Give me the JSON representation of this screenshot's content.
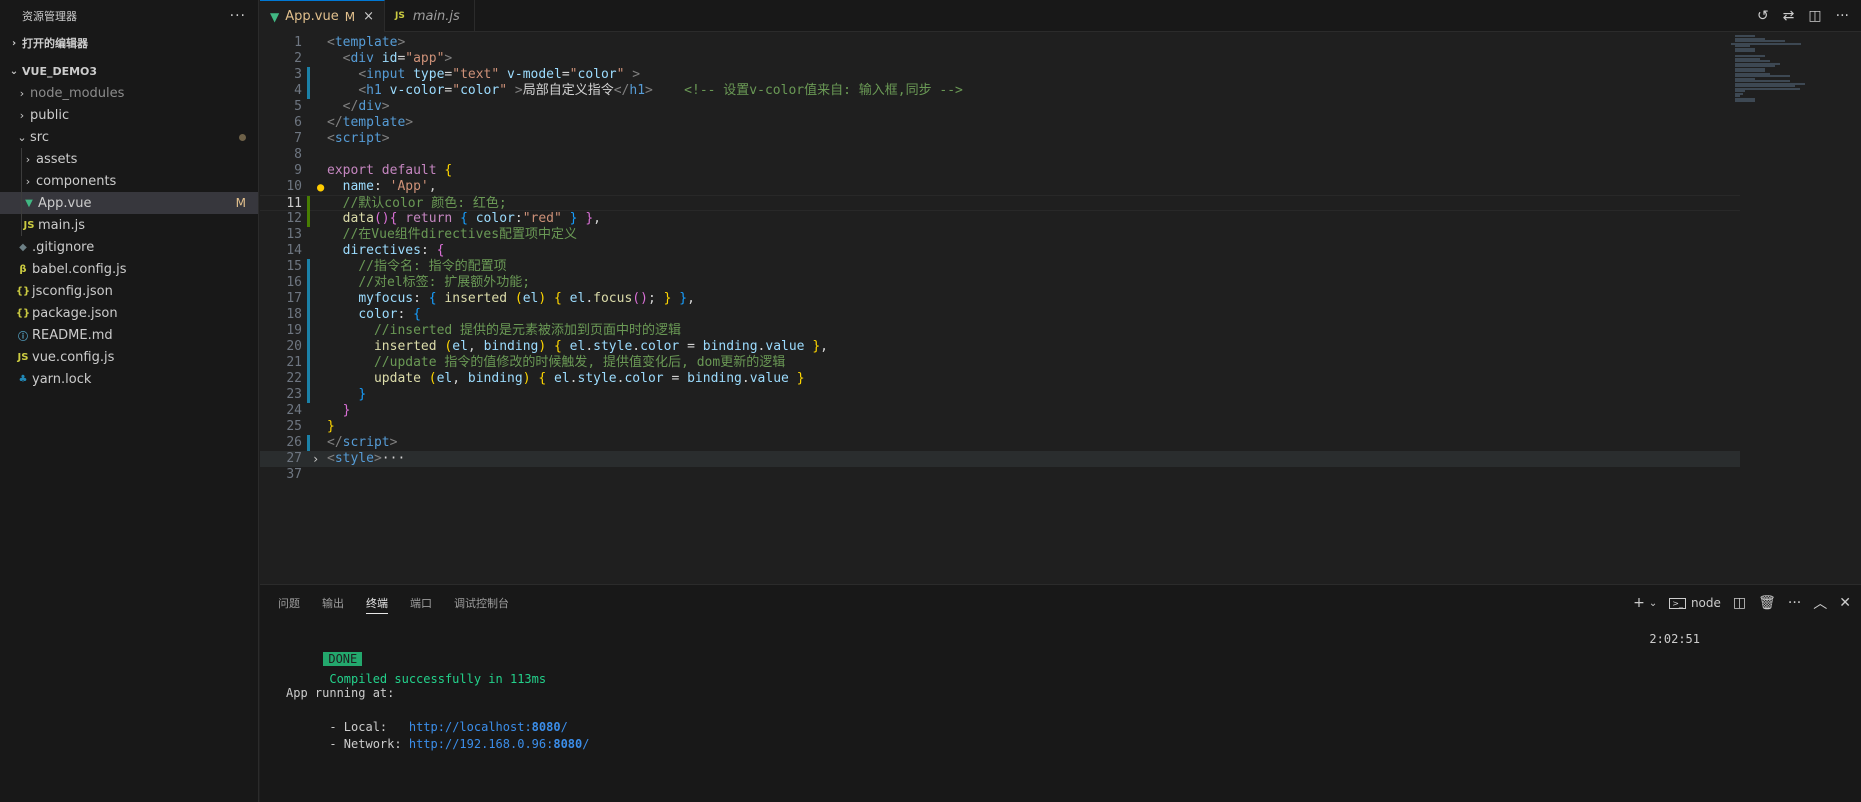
{
  "sidebar": {
    "title": "资源管理器",
    "more": "···",
    "open_editors": "打开的编辑器",
    "project": "VUE_DEMO3",
    "items": [
      {
        "label": "node_modules",
        "kind": "folder",
        "chevron": "›",
        "icon": "",
        "badge": ""
      },
      {
        "label": "public",
        "kind": "folder",
        "chevron": "›",
        "icon": "",
        "badge": ""
      },
      {
        "label": "src",
        "kind": "folder-open",
        "chevron": "⌄",
        "icon": "",
        "badge": "dot"
      },
      {
        "label": "assets",
        "kind": "folder",
        "chevron": "›",
        "icon": "",
        "badge": ""
      },
      {
        "label": "components",
        "kind": "folder",
        "chevron": "›",
        "icon": "",
        "badge": ""
      },
      {
        "label": "App.vue",
        "kind": "vue",
        "chevron": "",
        "icon": "▼",
        "badge": "M"
      },
      {
        "label": "main.js",
        "kind": "js",
        "chevron": "",
        "icon": "JS",
        "badge": ""
      },
      {
        "label": ".gitignore",
        "kind": "git",
        "chevron": "",
        "icon": "◆",
        "badge": ""
      },
      {
        "label": "babel.config.js",
        "kind": "babel",
        "chevron": "",
        "icon": "β",
        "badge": ""
      },
      {
        "label": "jsconfig.json",
        "kind": "json",
        "chevron": "",
        "icon": "{}",
        "badge": ""
      },
      {
        "label": "package.json",
        "kind": "json",
        "chevron": "",
        "icon": "{}",
        "badge": ""
      },
      {
        "label": "README.md",
        "kind": "info",
        "chevron": "",
        "icon": "ⓘ",
        "badge": ""
      },
      {
        "label": "vue.config.js",
        "kind": "js",
        "chevron": "",
        "icon": "JS",
        "badge": ""
      },
      {
        "label": "yarn.lock",
        "kind": "yarn",
        "chevron": "",
        "icon": "♣",
        "badge": ""
      }
    ]
  },
  "tabs": [
    {
      "label": "App.vue",
      "modified": "M",
      "close": "×",
      "icon": "vue-icon"
    },
    {
      "label": "main.js",
      "icon": "js-icon"
    }
  ],
  "editor": {
    "line_numbers": [
      "1",
      "2",
      "3",
      "4",
      "5",
      "6",
      "7",
      "8",
      "9",
      "10",
      "11",
      "12",
      "13",
      "14",
      "15",
      "16",
      "17",
      "18",
      "19",
      "20",
      "21",
      "22",
      "23",
      "24",
      "25",
      "26",
      "27",
      "37"
    ],
    "current_line": "11",
    "fold_ellipsis": "···"
  },
  "panel": {
    "tabs": [
      "问题",
      "输出",
      "终端",
      "端口",
      "调试控制台"
    ],
    "active_tab": "终端",
    "shell": "node",
    "terminal": {
      "done": "DONE",
      "compiled": "Compiled successfully in 113ms",
      "time": "2:02:51",
      "running": "App running at:",
      "local_label": "- Local:   ",
      "local_url_prefix": "http://localhost:",
      "local_port": "8080",
      "local_url_suffix": "/",
      "network_label": "- Network: ",
      "network_url_prefix": "http://192.168.0.96:",
      "network_port": "8080",
      "network_url_suffix": "/"
    }
  },
  "colors": {
    "accent": "#0078d4",
    "modified": "#e2c08d",
    "vue_green": "#41b883",
    "js_yellow": "#cbcb41"
  }
}
